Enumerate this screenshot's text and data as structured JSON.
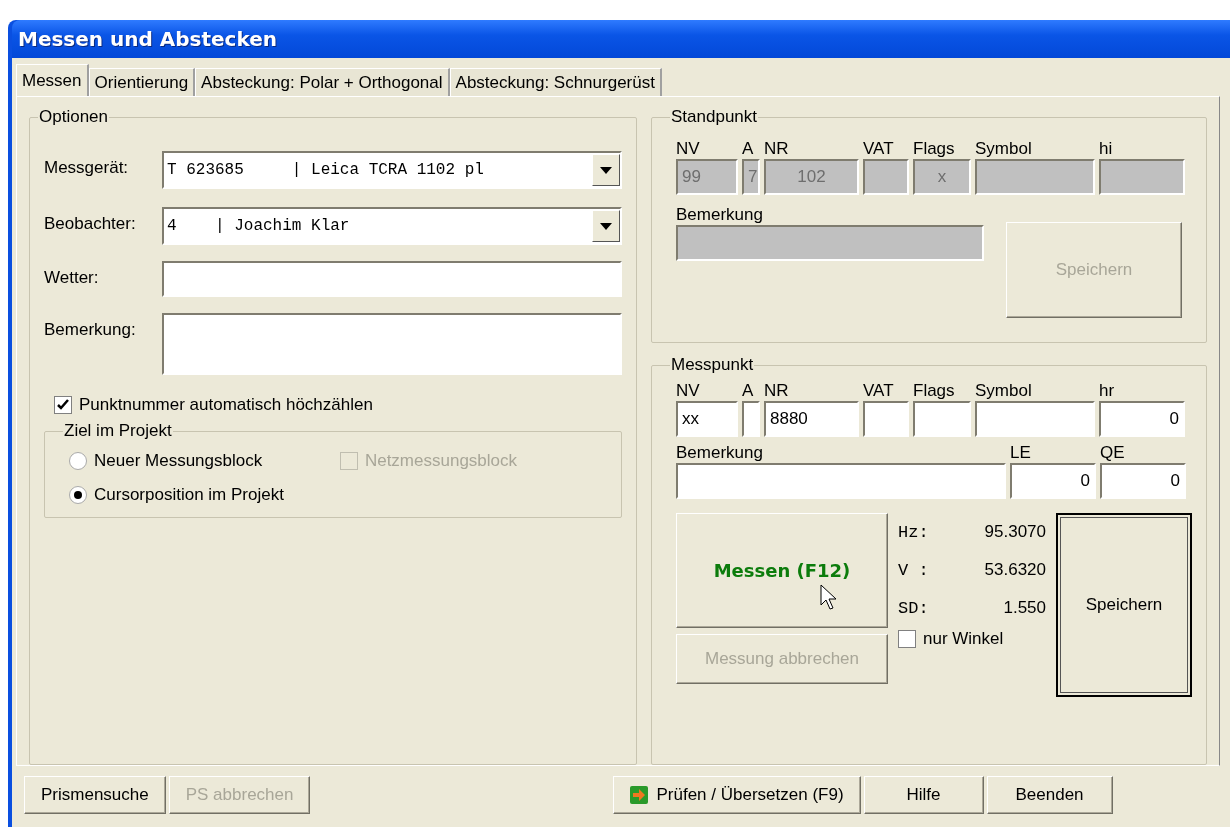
{
  "window": {
    "title": "Messen und Abstecken"
  },
  "tabs": [
    {
      "label": "Messen",
      "selected": true
    },
    {
      "label": "Orientierung",
      "selected": false
    },
    {
      "label": "Absteckung: Polar + Orthogonal",
      "selected": false
    },
    {
      "label": "Absteckung: Schnurgerüst",
      "selected": false
    }
  ],
  "options": {
    "title": "Optionen",
    "fields": [
      {
        "kind": "combo",
        "label": "Messgerät:",
        "value": "T 623685     | Leica TCRA 1102 pl"
      },
      {
        "kind": "combo",
        "label": "Beobachter:",
        "value": "4    | Joachim Klar"
      },
      {
        "kind": "text",
        "label": "Wetter:"
      },
      {
        "kind": "memo",
        "label": "Bemerkung:"
      }
    ],
    "auto_increment": {
      "label": "Punktnummer automatisch höchzählen",
      "checked": true
    },
    "target": {
      "title": "Ziel im Projekt",
      "choices": [
        {
          "label": "Neuer Messungsblock",
          "selected": false
        },
        {
          "label": "Cursorposition im Projekt",
          "selected": true
        }
      ],
      "net_block": {
        "label": "Netzmessungsblock",
        "checked": false,
        "disabled": true
      }
    }
  },
  "standpunkt": {
    "title": "Standpunkt",
    "disabled": true,
    "columns": [
      {
        "label": "NV",
        "value": "99"
      },
      {
        "label": "A",
        "value": "7"
      },
      {
        "label": "NR",
        "value": "102"
      },
      {
        "label": "VAT"
      },
      {
        "label": "Flags",
        "value": "x"
      },
      {
        "label": "Symbol"
      },
      {
        "label": "hi"
      }
    ],
    "remark_label": "Bemerkung",
    "save_button": {
      "label": "Speichern",
      "disabled": true
    }
  },
  "messpunkt": {
    "title": "Messpunkt",
    "columns": [
      {
        "label": "NV",
        "value": "xx"
      },
      {
        "label": "A"
      },
      {
        "label": "NR",
        "value": "8880"
      },
      {
        "label": "VAT"
      },
      {
        "label": "Flags"
      },
      {
        "label": "Symbol"
      },
      {
        "label": "hr",
        "value": "0"
      }
    ],
    "remark_label": "Bemerkung",
    "le": {
      "label": "LE",
      "value": "0"
    },
    "qe": {
      "label": "QE",
      "value": "0"
    },
    "measure_button": {
      "label": "Messen (F12)"
    },
    "readings": [
      {
        "label": "Hz:",
        "value": "95.3070"
      },
      {
        "label": "V :",
        "value": "53.6320"
      },
      {
        "label": "SD:",
        "value": "1.550"
      }
    ],
    "angle_only": {
      "label": "nur Winkel",
      "checked": false
    },
    "cancel_button": {
      "label": "Messung abbrechen",
      "disabled": true
    },
    "save_button": {
      "label": "Speichern",
      "disabled": false,
      "default": true
    }
  },
  "buttons": [
    {
      "label": "Prismensuche",
      "disabled": false
    },
    {
      "label": "PS abbrechen",
      "disabled": true
    },
    {
      "label": "Prüfen / Übersetzen (F9)",
      "disabled": false,
      "kind": "arrow"
    },
    {
      "label": "Hilfe",
      "disabled": false
    },
    {
      "label": "Beenden",
      "disabled": false
    }
  ]
}
